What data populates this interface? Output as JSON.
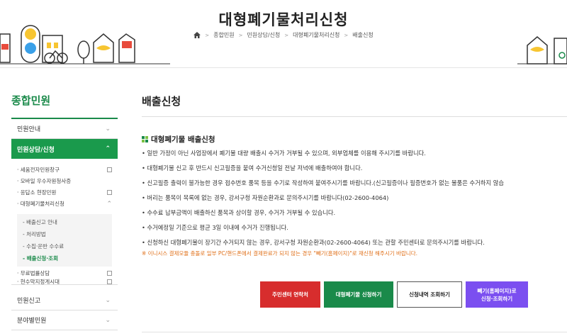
{
  "header": {
    "title": "대형폐기물처리신청",
    "breadcrumb": [
      "종합민원",
      "민원상담/신청",
      "대형폐기물처리신청",
      "배출신청"
    ]
  },
  "sidebar": {
    "heading": "종합민원",
    "menu": [
      {
        "label": "민원안내"
      },
      {
        "label": "민원상담/신청"
      },
      {
        "label": "민원신고"
      },
      {
        "label": "분야별민원"
      }
    ],
    "sub_items": [
      {
        "label": "· 세움전자민원창구"
      },
      {
        "label": "· 모바일 우수자원청사증"
      },
      {
        "label": "· 응답소 현장민원"
      },
      {
        "label": "· 대형폐기물처리신청"
      },
      {
        "label": "· 무료법률상담"
      },
      {
        "label": "· 현수막지정게시대"
      }
    ],
    "subsub_items": [
      {
        "label": "- 배출신고 안내"
      },
      {
        "label": "- 처리방법"
      },
      {
        "label": "- 수집·운반 수수료"
      },
      {
        "label": "- 배출신청·조회"
      }
    ]
  },
  "main": {
    "title": "배출신청",
    "section_title": "대형폐기물 배출신청",
    "bullets": [
      "• 일반 가정이 아닌 사업장에서 폐기물 대량 배출시 수거가 거부될 수 있으며, 외부업체를 이용해 주시기를 바랍니다.",
      "• 대형폐기물 신고 후 반드시 신고필증을 붙여 수거신청일 전날 저녁에 배출하여야 합니다.",
      "• 신고필증 출력이 불가능한 경우 접수번호 품목 등을 수기로 작성하여 붙여주시기를 바랍니다.(신고필증이나 필증번호가 없는 물품은 수거하지 않습",
      "• 버리는 품목이 목록에 없는 경우, 강서구청 자원순환과로 문의주시기를 바랍니다(02-2600-4064)",
      "• 수수료 납부금액이 배출하신 품목과 상이할 경우, 수거가 거부될 수 있습니다.",
      "• 수거예정일 기준으로 평균 3일 이내에 수거가 진행됩니다.",
      "• 신청하신 대형폐기물이 장기간 수거되지 않는 경우, 강서구청 자원순환과(02-2600-4064) 또는 관할 주민센터로 문의주시기를 바랍니다."
    ],
    "note": "※ 이니시스 결제모듈 충돌로 일부 PC/핸드폰에서 결제완료가 되지 않는 경우 \"빼기(홈페이지)\"로 재신청 해주시기 바랍니다.",
    "buttons": {
      "contact": "주민센터 연락처",
      "apply": "대형폐기물 신청하기",
      "history": "신청내역 조회하기",
      "ppaegi_line1": "빼기(홈페이지)로",
      "ppaegi_line2": "신청·조회하기"
    }
  },
  "colors": {
    "brand_green": "#1a8a4a",
    "red": "#d72d2d",
    "purple": "#7b4ff0",
    "note_orange": "#e0701a"
  }
}
